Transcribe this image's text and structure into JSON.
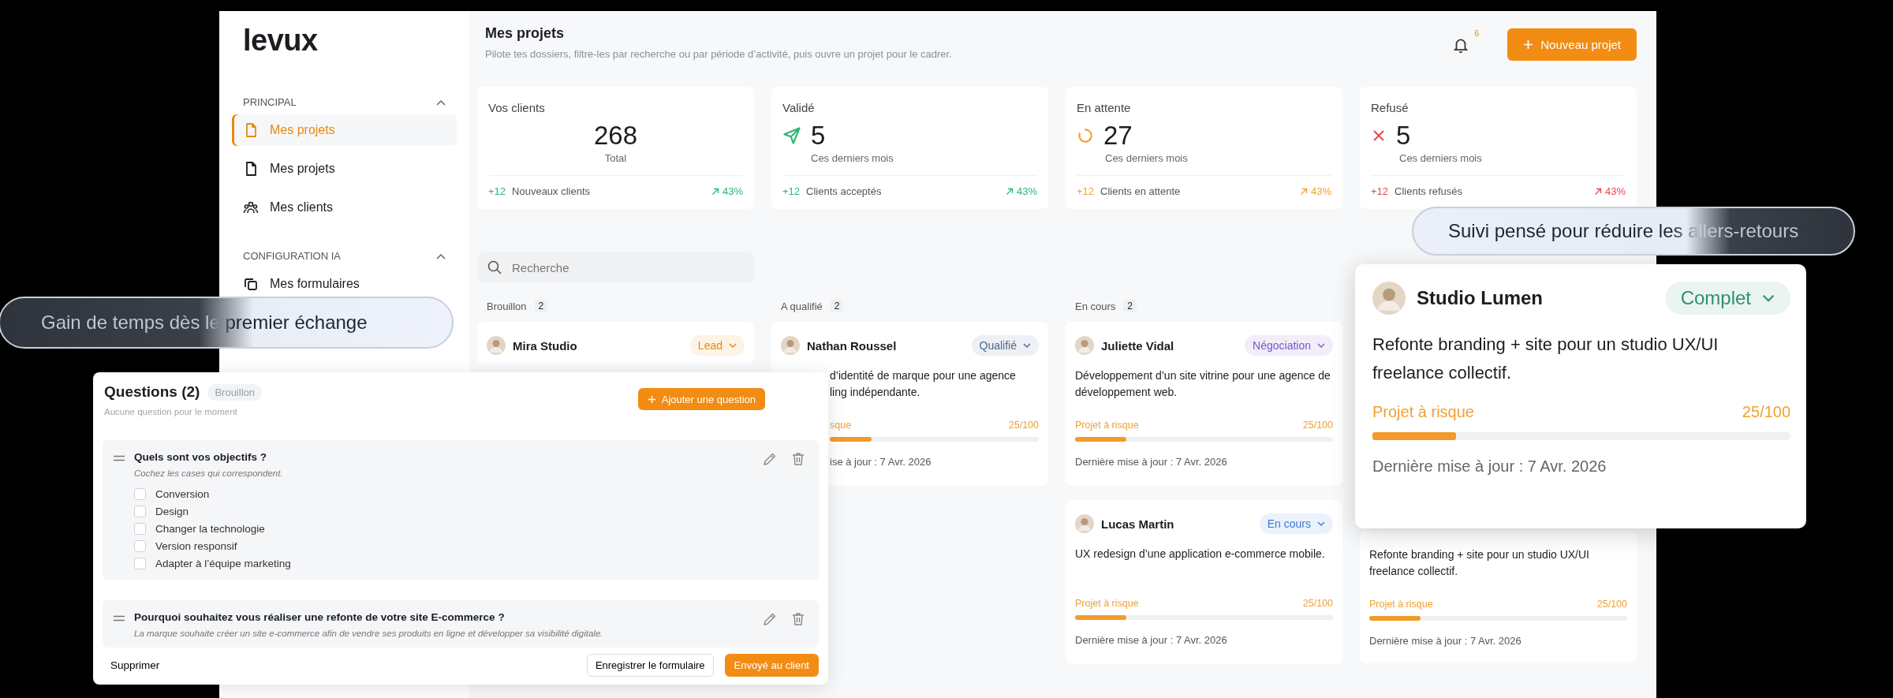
{
  "sidebar": {
    "logo": "levux",
    "sections": [
      {
        "title": "PRINCIPAL",
        "expanded": true,
        "items": [
          {
            "label": "Mes projets",
            "selected": true
          },
          {
            "label": "Mes projets",
            "selected": false
          },
          {
            "label": "Mes clients",
            "selected": false
          }
        ]
      },
      {
        "title": "CONFIGURATION IA",
        "expanded": true,
        "items": [
          {
            "label": "Mes formulaires",
            "selected": false
          }
        ]
      }
    ]
  },
  "header": {
    "title": "Mes projets",
    "subtitle": "Pilote tes dossiers, filtre-les par recherche ou par période d’activité, puis ouvre un projet pour le cadrer.",
    "notifications": "6",
    "new_button": "Nouveau projet"
  },
  "stats": [
    {
      "kind": "total",
      "label": "Vos clients",
      "value": "268",
      "caption": "Total",
      "delta": "+12",
      "delta_label": "Nouveaux clients",
      "trend": "43%",
      "color": "#2bb673"
    },
    {
      "kind": "status",
      "label": "Validé",
      "value": "5",
      "caption": "Ces derniers mois",
      "delta": "+12",
      "delta_label": "Clients acceptés",
      "trend": "43%",
      "color": "#2bb673"
    },
    {
      "kind": "status",
      "label": "En attente",
      "value": "27",
      "caption": "Ces derniers mois",
      "delta": "+12",
      "delta_label": "Clients en attente",
      "trend": "43%",
      "color": "#f0a030"
    },
    {
      "kind": "status",
      "label": "Refusé",
      "value": "5",
      "caption": "Ces derniers mois",
      "delta": "+12",
      "delta_label": "Clients refusés",
      "trend": "43%",
      "color": "#e5484d"
    }
  ],
  "search": {
    "placeholder": "Recherche"
  },
  "columns": [
    {
      "label": "Brouillon",
      "count": "2",
      "cards": [
        {
          "kind": "header",
          "name": "Mira Studio",
          "status": "Lead",
          "color": "#e8890c"
        }
      ]
    },
    {
      "label": "A qualifié",
      "count": "2",
      "cards": [
        {
          "kind": "clipped",
          "name": "Nathan Roussel",
          "status": "Qualifié",
          "color": "#4a6a90",
          "description": "d’identité de marque pour une agence\nling indépendante.",
          "risk_label": "sque",
          "score": "25/100",
          "level": 0.2,
          "updated": "ise à jour : 7 Avr. 2026"
        }
      ]
    },
    {
      "label": "En cours",
      "count": "2",
      "cards": [
        {
          "kind": "full",
          "name": "Juliette Vidal",
          "status": "Négociation",
          "color": "#7a55c8",
          "description": "Développement d’un site vitrine pour une agence de développement web.",
          "risk_label": "Projet à risque",
          "score": "25/100",
          "level": 0.2,
          "updated": "Dernière mise à jour : 7 Avr. 2026"
        },
        {
          "kind": "full",
          "name": "Lucas Martin",
          "status": "En cours",
          "color": "#3a7bd5",
          "description": "UX redesign d’une application e-commerce mobile.",
          "risk_label": "Projet à risque",
          "score": "25/100",
          "level": 0.2,
          "updated": "Dernière mise à jour : 7 Avr. 2026"
        }
      ]
    },
    {
      "cards": [
        {
          "kind": "body",
          "description": "Refonte branding + site pour un studio UX/UI freelance collectif.",
          "risk_label": "Projet à risque",
          "score": "25/100",
          "level": 0.2,
          "updated": "Dernière mise à jour : 7 Avr. 2026"
        }
      ]
    }
  ],
  "questions_panel": {
    "title": "Questions (2)",
    "status": "Brouillon",
    "subtitle": "Aucune question pour le moment",
    "add_button": "Ajouter une question",
    "questions": [
      {
        "kind": "checkboxes",
        "title": "Quels sont vos objectifs ?",
        "hint": "Cochez les cases qui correspondent.",
        "options": [
          {
            "label": "Conversion",
            "checked": false
          },
          {
            "label": "Design",
            "checked": false
          },
          {
            "label": "Changer la technologie",
            "checked": false
          },
          {
            "label": "Version responsif",
            "checked": false
          },
          {
            "label": "Adapter à l’équipe marketing",
            "checked": false
          }
        ]
      },
      {
        "kind": "text",
        "title": "Pourquoi souhaitez vous réaliser une refonte de votre site E-commerce ?",
        "answer": "La marque souhaite créer un site e-commerce afin de vendre ses produits en ligne et développer sa visibilité digitale."
      }
    ],
    "delete_button": "Supprimer",
    "save_button": "Enregistrer le formulaire",
    "send_button": "Envoyé au client"
  },
  "focus_card": {
    "name": "Studio Lumen",
    "status": "Complet",
    "color": "#2f8f74",
    "description": "Refonte branding + site pour un studio UX/UI freelance collectif.",
    "risk_label": "Projet à risque",
    "score": "25/100",
    "level": 0.2,
    "updated": "Dernière mise à jour : 7 Avr. 2026"
  },
  "callouts": [
    {
      "text": "Gain de temps dès le premier échange"
    },
    {
      "text": "Suivi pensé pour réduire les allers-retours"
    }
  ]
}
